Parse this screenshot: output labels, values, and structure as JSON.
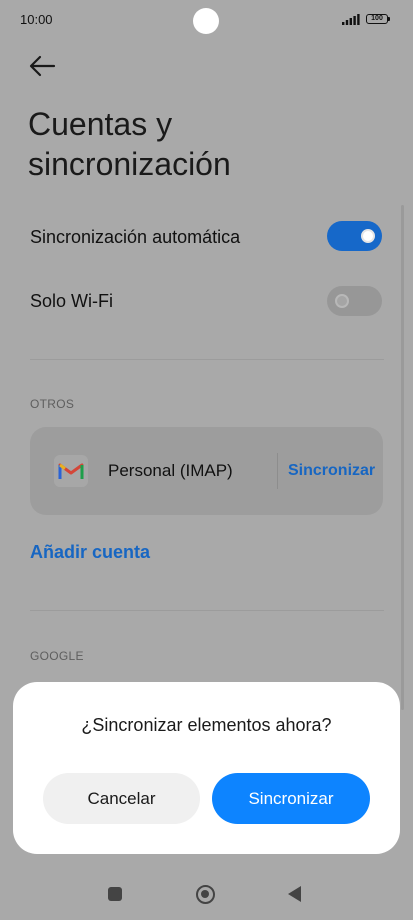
{
  "status_bar": {
    "time": "10:00",
    "battery": "100",
    "icons": [
      "signal-icon",
      "battery-icon"
    ]
  },
  "header": {
    "back_icon": "arrow-left-icon",
    "title": "Cuentas y sincronización"
  },
  "settings": {
    "auto_sync": {
      "label": "Sincronización automática",
      "enabled": true
    },
    "wifi_only": {
      "label": "Solo Wi-Fi",
      "enabled": false
    }
  },
  "sections": {
    "others": {
      "header": "OTROS",
      "account": {
        "icon": "gmail-icon",
        "name": "Personal (IMAP)",
        "sync_label": "Sincronizar"
      },
      "add_account": "Añadir cuenta"
    },
    "google": {
      "header": "GOOGLE"
    }
  },
  "dialog": {
    "title": "¿Sincronizar elementos ahora?",
    "cancel_label": "Cancelar",
    "confirm_label": "Sincronizar"
  },
  "nav_bar": {
    "icons": [
      "recents-square-icon",
      "home-circle-icon",
      "back-triangle-icon"
    ]
  },
  "colors": {
    "accent": "#1668c9",
    "dialog_button": "#0d84ff",
    "link": "#1766c2",
    "overlay_background": "#a9a9a9"
  }
}
